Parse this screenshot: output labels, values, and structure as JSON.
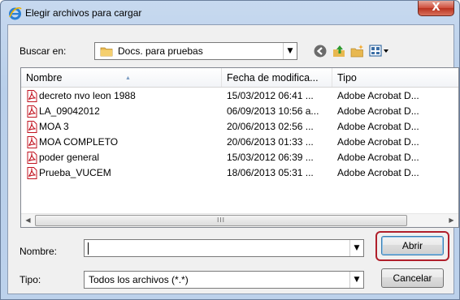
{
  "window": {
    "title": "Elegir archivos para cargar",
    "close_glyph": "X"
  },
  "toolbar": {
    "lookin_label": "Buscar en:",
    "lookin_value": "Docs. para pruebas",
    "icons": [
      "back-arrow-icon",
      "up-folder-icon",
      "new-folder-icon",
      "view-menu-icon"
    ]
  },
  "list": {
    "columns": [
      "Nombre",
      "Fecha de modifica...",
      "Tipo"
    ],
    "rows": [
      {
        "name": "decreto nvo leon 1988",
        "date": "15/03/2012 06:41 ...",
        "type": "Adobe Acrobat D..."
      },
      {
        "name": "LA_09042012",
        "date": "06/09/2013 10:56 a...",
        "type": "Adobe Acrobat D..."
      },
      {
        "name": "MOA 3",
        "date": "20/06/2013 02:56 ...",
        "type": "Adobe Acrobat D..."
      },
      {
        "name": "MOA COMPLETO",
        "date": "20/06/2013 01:33 ...",
        "type": "Adobe Acrobat D..."
      },
      {
        "name": "poder general",
        "date": "15/03/2012 06:39 ...",
        "type": "Adobe Acrobat D..."
      },
      {
        "name": "Prueba_VUCEM",
        "date": "18/06/2013 05:31 ...",
        "type": "Adobe Acrobat D..."
      }
    ],
    "scroll_grip": "III"
  },
  "filename": {
    "label": "Nombre:",
    "value": ""
  },
  "filetype": {
    "label": "Tipo:",
    "value": "Todos los archivos (*.*)"
  },
  "buttons": {
    "open": "Abrir",
    "cancel": "Cancelar"
  },
  "colors": {
    "highlight": "#b01f2b",
    "pdf_red": "#c1121f"
  }
}
